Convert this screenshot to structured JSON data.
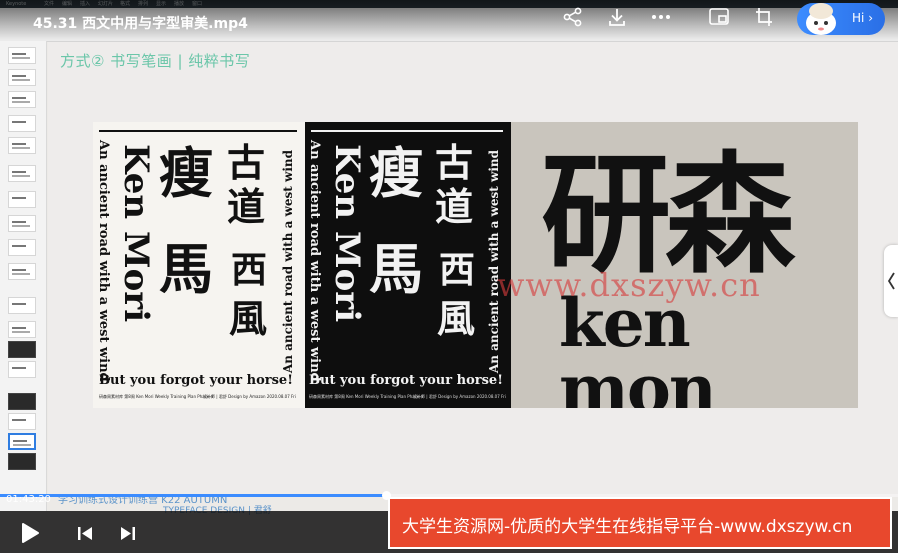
{
  "video": {
    "title": "45.31 西文中用与字型审美.mp4",
    "time": "01:43:20",
    "progress_fraction": 0.43
  },
  "overlay": {
    "hi_label": "Hi",
    "banner_text": "大学生资源网-优质的大学生在线指导平台-www.dxszyw.cn",
    "inline_watermark": "www.dxszyw.cn"
  },
  "slide": {
    "heading": "方式② 书写笔画 | 纯粹书写",
    "poster_vertical_en": "An ancient road with a west wind",
    "poster_name_en": "Ken Mori",
    "poster_tagline": "But you forgot your horse!",
    "poster_footer_left": "研森周素材库 第8周  Ken Mori Weekly Training Plan Phase 4",
    "poster_footer_right": "设计师 | 君舒  Design by Amazon  2020.08.07 Fri",
    "poster_glyphs": [
      "古",
      "道",
      "·",
      "西",
      "風",
      "瘦",
      "馬"
    ],
    "brand_cn": "研森",
    "brand_en": "ken mon"
  },
  "footer": {
    "caption": "学习训练式设计训练营 K22 AUTUMN",
    "sub": "TYPEFACE DESIGN | 君舒"
  },
  "colors": {
    "heading": "#6bc6a9",
    "banner": "#e8482d",
    "accent_blue": "#3b8cff"
  }
}
